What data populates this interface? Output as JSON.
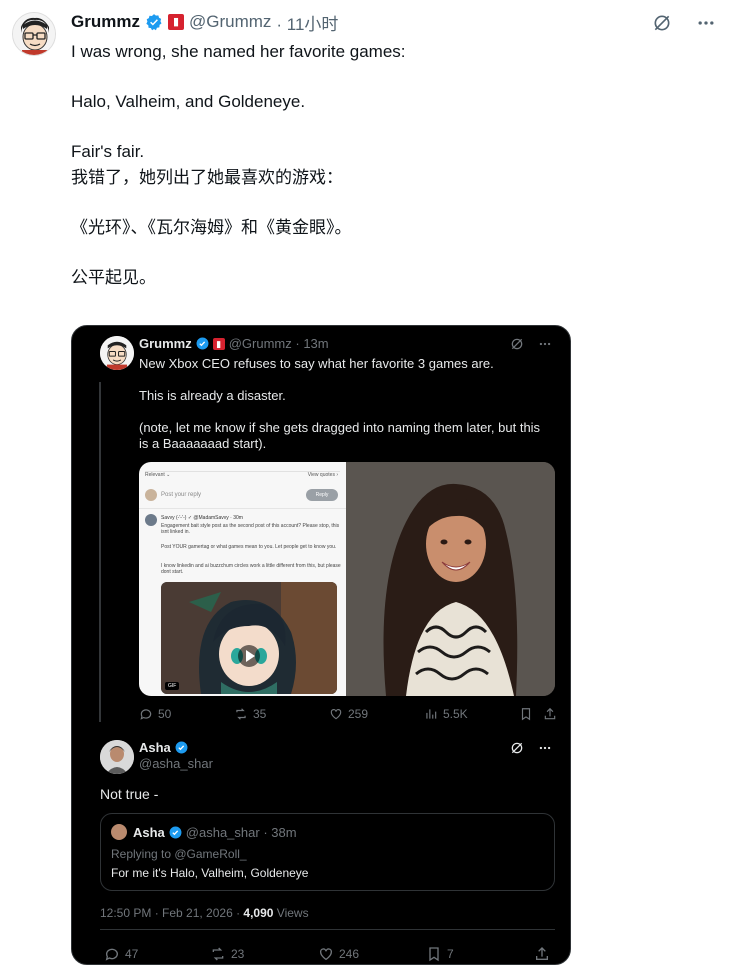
{
  "outer_tweet": {
    "name": "Grummz",
    "handle": "@Grummz",
    "time": "· 11小时",
    "paragraphs_en": [
      "I was wrong, she named her favorite games:",
      "Halo, Valheim, and Goldeneye.",
      "Fair's fair."
    ],
    "paragraphs_zh": [
      "我错了，她列出了她最喜欢的游戏：",
      "《光环》、《瓦尔海姆》和《黄金眼》。",
      "公平起见。"
    ]
  },
  "embedded": {
    "original_post": {
      "name": "Grummz",
      "handle": "@Grummz · 13m",
      "text_line1": "New Xbox CEO refuses to say what her favorite 3 games are.",
      "text_line2": "This is already a disaster.",
      "text_line3": "(note, let me know if she gets dragged into naming them later, but this is a Baaaaaaad start).",
      "media_left": {
        "relevant": "Relevant ⌄",
        "view_quotes": "View quotes ›",
        "post_reply": "Post your reply",
        "reply_btn": "Reply",
        "savvy_name": "Savvy (-'ᵕ'-) ✓ @MadamSavvy · 30m",
        "savvy_text1": "Engagement bait style post as the second post of this account? Please stop, this isnt linked in.",
        "savvy_text2": "Post YOUR gamertag or what games mean to you. Let people get to know you.",
        "savvy_text3": "I know linkedin and ai buzzchum circles work a little different from this, but please dont start.",
        "gif_label": "GIF"
      },
      "stats": {
        "replies": "50",
        "reposts": "35",
        "likes": "259",
        "views": "5.5K"
      }
    },
    "reply_post": {
      "name": "Asha",
      "handle": "@asha_shar",
      "text": "Not true -",
      "quote": {
        "name": "Asha",
        "handle": "@asha_shar · 38m",
        "replying_to": "Replying to @GameRoll_",
        "text": "For me it's Halo, Valheim, Goldeneye"
      },
      "meta_time": "12:50 PM · Feb 21, 2026 · ",
      "meta_views_count": "4,090",
      "meta_views_label": " Views",
      "stats": {
        "replies": "47",
        "reposts": "23",
        "likes": "246",
        "bookmarks": "7"
      }
    }
  },
  "icons": [
    "verified-badge-icon",
    "flag-icon",
    "grok-icon",
    "more-icon",
    "reply-icon",
    "repost-icon",
    "like-icon",
    "views-icon",
    "bookmark-icon",
    "share-icon"
  ],
  "colors": {
    "verified": "#1d9bf0",
    "card_bg": "#000000",
    "muted": "#71767b"
  }
}
